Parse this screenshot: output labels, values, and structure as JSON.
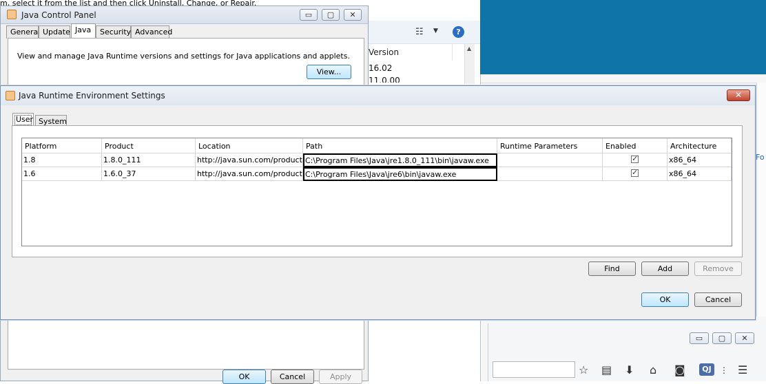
{
  "background": {
    "instruction_text": "m, select it from the list and then click Uninstall, Change, or Repair.",
    "explorer": {
      "version_header": "Version",
      "versions": [
        "16.02",
        "11.0.00"
      ]
    },
    "right_link_fragment": "Fo"
  },
  "control_panel": {
    "title": "Java Control Panel",
    "tabs": [
      "General",
      "Update",
      "Java",
      "Security",
      "Advanced"
    ],
    "active_tab": "Java",
    "description": "View and manage Java Runtime versions and settings for Java applications and applets.",
    "view_button": "View...",
    "ok_button": "OK",
    "cancel_button": "Cancel",
    "apply_button": "Apply",
    "title_buttons": {
      "minimize": "▭",
      "maximize": "▢",
      "close": "✕"
    }
  },
  "jre_dialog": {
    "title": "Java Runtime Environment Settings",
    "close_glyph": "✕",
    "tabs": [
      "User",
      "System"
    ],
    "active_tab": "User",
    "columns": [
      "Platform",
      "Product",
      "Location",
      "Path",
      "Runtime Parameters",
      "Enabled",
      "Architecture"
    ],
    "rows": [
      {
        "platform": "1.8",
        "product": "1.8.0_111",
        "location": "http://java.sun.com/product...",
        "path": "C:\\Program Files\\Java\\jre1.8.0_111\\bin\\javaw.exe",
        "runtime_parameters": "",
        "enabled": true,
        "architecture": "x86_64"
      },
      {
        "platform": "1.6",
        "product": "1.6.0_37",
        "location": "http://java.sun.com/product...",
        "path": "C:\\Program Files\\Java\\jre6\\bin\\javaw.exe",
        "runtime_parameters": "",
        "enabled": true,
        "architecture": "x86_64"
      }
    ],
    "find_button": "Find",
    "add_button": "Add",
    "remove_button": "Remove",
    "ok_button": "OK",
    "cancel_button": "Cancel"
  },
  "browser_bar": {
    "qj_badge": "QJ",
    "title_buttons": {
      "minimize": "▭",
      "maximize": "▢",
      "close": "✕"
    }
  }
}
